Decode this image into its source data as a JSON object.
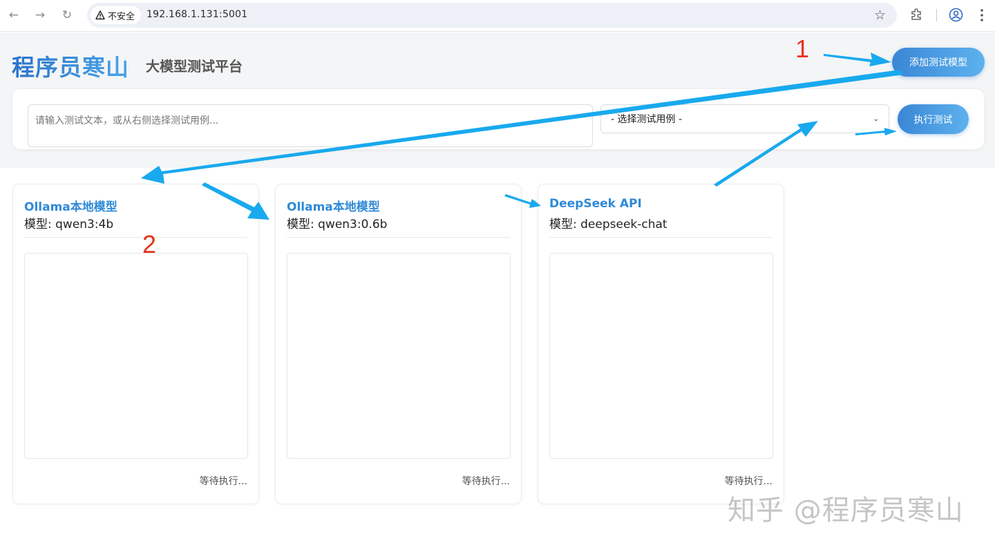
{
  "browser": {
    "security_label": "不安全",
    "url": "192.168.1.131:5001"
  },
  "header": {
    "brand": "程序员寒山",
    "subtitle": "大模型测试平台",
    "add_model_label": "添加测试模型"
  },
  "controls": {
    "input_placeholder": "请输入测试文本，或从右侧选择测试用例...",
    "select_value": "- 选择测试用例 -",
    "run_label": "执行测试"
  },
  "cards": [
    {
      "title": "Ollama本地模型",
      "model": "模型: qwen3:4b",
      "status": "等待执行..."
    },
    {
      "title": "Ollama本地模型",
      "model": "模型: qwen3:0.6b",
      "status": "等待执行..."
    },
    {
      "title": "DeepSeek API",
      "model": "模型: deepseek-chat",
      "status": "等待执行..."
    }
  ],
  "annotations": {
    "marker_1": "1",
    "marker_2": "2",
    "arrow_color": "#19a9ee",
    "marker_color": "#e8321e"
  },
  "watermark": "知乎 @程序员寒山"
}
